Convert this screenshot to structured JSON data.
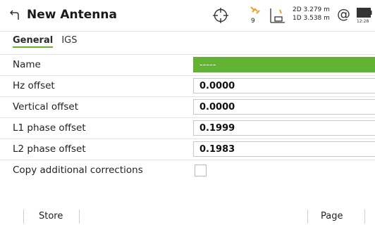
{
  "titlebar": {
    "title": "New Antenna",
    "satellite_count": "9",
    "quality_2d": "2D 3.279 m",
    "quality_1d": "1D 3.538 m",
    "at_symbol": "@",
    "clock": "12:28"
  },
  "tabs": [
    {
      "label": "General",
      "active": true
    },
    {
      "label": "IGS",
      "active": false
    }
  ],
  "form": {
    "name_label": "Name",
    "name_value": "-----",
    "hz_label": "Hz offset",
    "hz_value": "0.0000",
    "vertical_label": "Vertical offset",
    "vertical_value": "0.0000",
    "l1_label": "L1 phase offset",
    "l1_value": "0.1999",
    "l2_label": "L2 phase offset",
    "l2_value": "0.1983",
    "copy_label": "Copy additional corrections",
    "copy_checked": false
  },
  "softkeys": {
    "store": "Store",
    "page": "Page"
  },
  "colors": {
    "accent": "#62b233",
    "satellite": "#f0a020"
  }
}
